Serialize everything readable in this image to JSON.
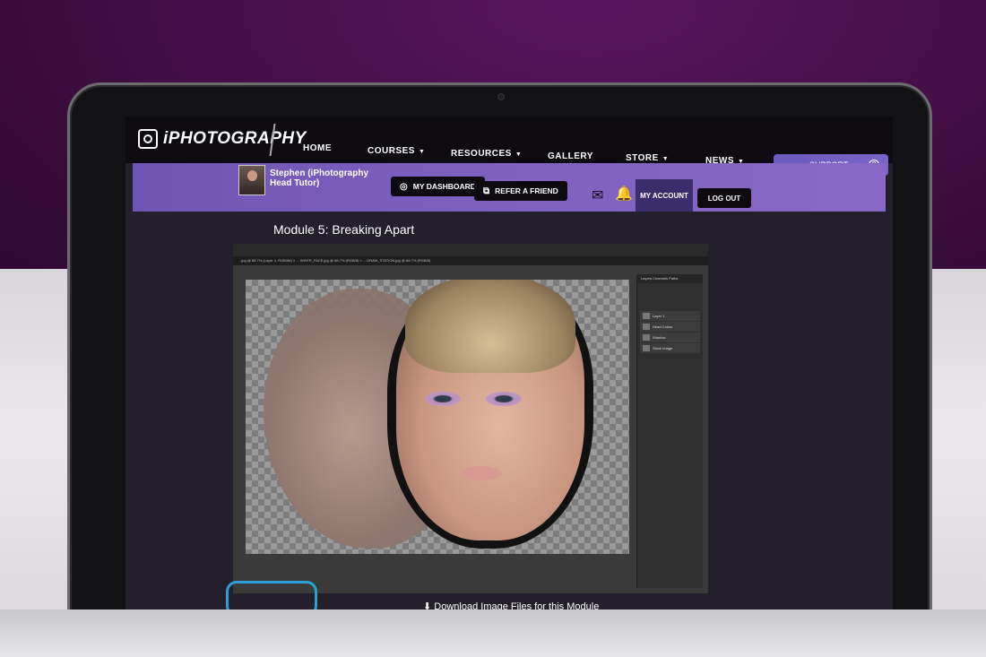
{
  "brand": {
    "name": "iPHOTOGRAPHY"
  },
  "nav": {
    "items": [
      {
        "label": "HOME",
        "caret": false
      },
      {
        "label": "COURSES",
        "caret": true
      },
      {
        "label": "RESOURCES",
        "caret": true
      },
      {
        "label": "GALLERY",
        "caret": false
      },
      {
        "label": "STORE",
        "caret": true
      },
      {
        "label": "NEWS",
        "caret": true
      }
    ],
    "support_label": "SUPPORT",
    "support_help": "?"
  },
  "user": {
    "name": "Stephen (iPhotography Head Tutor)",
    "dashboard_label": "MY DASHBOARD",
    "refer_label": "REFER A FRIEND",
    "account_label": "MY ACCOUNT",
    "logout_label": "LOG OUT"
  },
  "module": {
    "title": "Module 5: Breaking Apart"
  },
  "editor": {
    "tabs_text": "...jpg @ 66.7% (Layer 1, RGB/8#) × ... WHITE_FACE.jpg @ 66.7% (RGB/8) × ... DRAW_STATION.jpg @ 66.7% (RGB/8)",
    "panel_tabs": "Layers  Channels  Paths",
    "layers": [
      "Layer 1",
      "Head Colour",
      "Shadow",
      "Stock Image"
    ]
  },
  "download": {
    "label": "Download Image Files for this Module"
  },
  "colors": {
    "accent": "#7b5fbf",
    "nav_bg": "#0d0b10",
    "page_bg": "#231f2b",
    "outline_btn": "#2c9fd9"
  },
  "icons": [
    "dashboard-icon",
    "refer-icon",
    "mail-icon",
    "bell-icon",
    "help-icon",
    "download-icon"
  ]
}
